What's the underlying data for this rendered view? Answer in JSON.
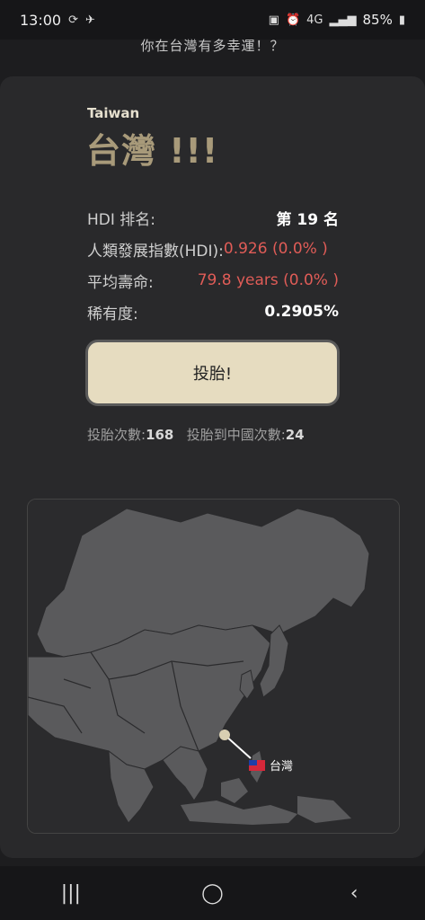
{
  "status_bar": {
    "time": "13:00",
    "battery": "85%",
    "network": "4G"
  },
  "subtitle": "你在台灣有多幸運！？",
  "country": {
    "name_en": "Taiwan",
    "name_zh": "台灣 !!!"
  },
  "stats": {
    "hdi_rank_label": "HDI 排名:",
    "hdi_rank_value": "第 19 名",
    "hdi_index_label": "人類發展指數(HDI):",
    "hdi_index_value": "0.926 (0.0% )",
    "life_label": "平均壽命:",
    "life_value": "79.8 years (0.0% )",
    "rarity_label": "稀有度:",
    "rarity_value": "0.2905%"
  },
  "roll_button": "投胎!",
  "counts": {
    "roll_label": "投胎次數:",
    "roll_value": "168",
    "china_label": "投胎到中國次數:",
    "china_value": "24"
  },
  "map": {
    "pin_label": "台灣"
  },
  "colors": {
    "accent_gold": "#a89a7a",
    "button_bg": "#e6dcc0",
    "highlight_red": "#e05c57"
  },
  "nav": {
    "recent_icon": "|||",
    "home_icon": "◯",
    "back_icon": "‹"
  }
}
